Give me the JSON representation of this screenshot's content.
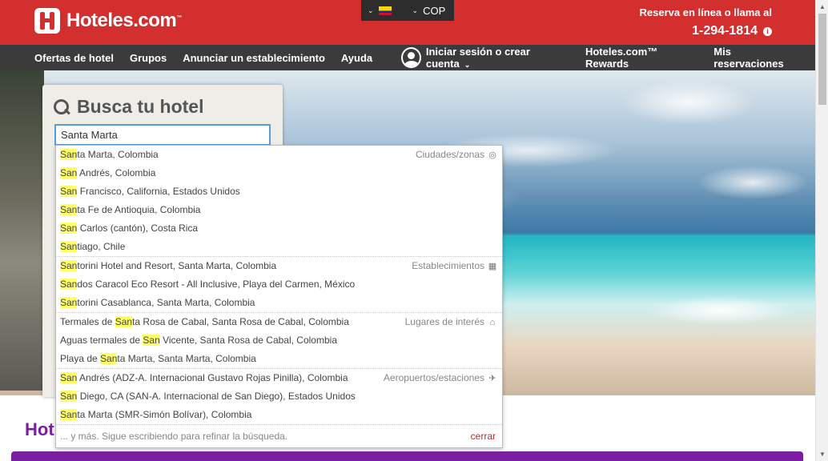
{
  "header": {
    "logo_text": "Hoteles.com",
    "logo_tm": "™",
    "currency": "COP",
    "reserve_text": "Reserva en línea o llama al",
    "phone": "1-294-1814",
    "info_glyph": "i"
  },
  "nav": {
    "left": [
      "Ofertas de hotel",
      "Grupos",
      "Anunciar un establecimiento",
      "Ayuda"
    ],
    "signin": "Iniciar sesión o crear cuenta",
    "rewards": "Hoteles.com™ Rewards",
    "reservations": "Mis reservaciones"
  },
  "search": {
    "title": "Busca tu hotel",
    "value": "Santa Marta"
  },
  "dropdown": {
    "groups": [
      {
        "category": "Ciudades/zonas",
        "icon": "target-icon",
        "glyph": "◎",
        "rows": [
          {
            "hl": "San",
            "rest": "ta Marta, Colombia"
          },
          {
            "hl": "San",
            "rest": " Andrés, Colombia"
          },
          {
            "hl": "San",
            "rest": " Francisco, California, Estados Unidos"
          },
          {
            "hl": "San",
            "rest": "ta Fe de Antioquia, Colombia"
          },
          {
            "hl": "San",
            "rest": " Carlos (cantón), Costa Rica"
          },
          {
            "hl": "San",
            "rest": "tiago, Chile"
          }
        ]
      },
      {
        "category": "Establecimientos",
        "icon": "building-icon",
        "glyph": "▦",
        "rows": [
          {
            "hl": "San",
            "rest": "torini Hotel and Resort, Santa Marta, Colombia"
          },
          {
            "hl": "San",
            "rest": "dos Caracol Eco Resort - All Inclusive, Playa del Carmen, México"
          },
          {
            "hl": "San",
            "rest": "torini Casablanca, Santa Marta, Colombia"
          }
        ]
      },
      {
        "category": "Lugares de interés",
        "icon": "landmark-icon",
        "glyph": "⌂",
        "rows": [
          {
            "pre": "Termales de ",
            "hl": "San",
            "rest": "ta Rosa de Cabal, Santa Rosa de Cabal, Colombia"
          },
          {
            "pre": "Aguas termales de ",
            "hl": "San",
            "rest": " Vicente, Santa Rosa de Cabal, Colombia"
          },
          {
            "pre": "Playa de ",
            "hl": "San",
            "rest": "ta Marta, Santa Marta, Colombia"
          }
        ]
      },
      {
        "category": "Aeropuertos/estaciones",
        "icon": "plane-train-icon",
        "glyph": "✈",
        "rows": [
          {
            "hl": "San",
            "rest": " Andrés (ADZ-A. Internacional Gustavo Rojas Pinilla), Colombia"
          },
          {
            "hl": "San",
            "rest": " Diego, CA (SAN-A. Internacional de San Diego), Estados Unidos"
          },
          {
            "hl": "San",
            "rest": "ta Marta (SMR-Simón Bolívar), Colombia"
          }
        ]
      }
    ],
    "more_text": "... y más. Sigue escribiendo para refinar la búsqueda.",
    "close_label": "cerrar"
  },
  "bottom": {
    "title_partial": "Hot"
  }
}
